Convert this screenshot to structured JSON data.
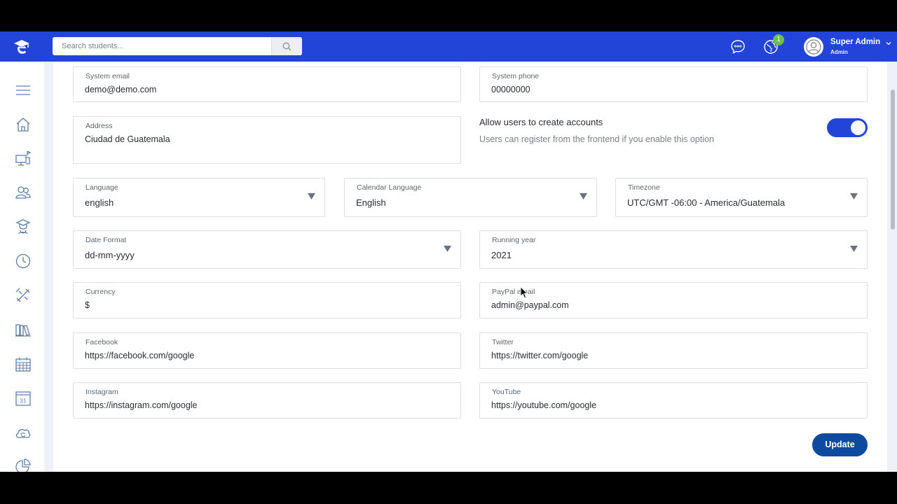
{
  "header": {
    "search_placeholder": "Search students...",
    "notification_count": "1",
    "user_name": "Super Admin",
    "user_role": "Admin",
    "brand_color": "#2244d8"
  },
  "sidebar": {
    "icons": [
      "menu-icon",
      "home-icon",
      "classroom-icon",
      "users-icon",
      "graduate-icon",
      "clock-icon",
      "tools-icon",
      "library-icon",
      "calendar-grid-icon",
      "calendar-31-icon",
      "cloud-sync-icon",
      "pie-chart-icon"
    ]
  },
  "form": {
    "system_email": {
      "label": "System email",
      "value": "demo@demo.com"
    },
    "system_phone": {
      "label": "System phone",
      "value": "00000000"
    },
    "address": {
      "label": "Address",
      "value": "Ciudad de Guatemala"
    },
    "allow_accounts": {
      "title": "Allow users to create accounts",
      "description": "Users can register from the frontend if you enable this option",
      "enabled": true
    },
    "language": {
      "label": "Language",
      "value": "english"
    },
    "calendar_language": {
      "label": "Calendar Language",
      "value": "English"
    },
    "timezone": {
      "label": "Timezone",
      "value": "UTC/GMT -06:00 - America/Guatemala"
    },
    "date_format": {
      "label": "Date Format",
      "value": "dd-mm-yyyy"
    },
    "running_year": {
      "label": "Running year",
      "value": "2021"
    },
    "currency": {
      "label": "Currency",
      "value": "$"
    },
    "paypal_email": {
      "label": "PayPal email",
      "value": "admin@paypal.com"
    },
    "facebook": {
      "label": "Facebook",
      "value": "https://facebook.com/google"
    },
    "twitter": {
      "label": "Twitter",
      "value": "https://twitter.com/google"
    },
    "instagram": {
      "label": "Instagram",
      "value": "https://instagram.com/google"
    },
    "youtube": {
      "label": "YouTube",
      "value": "https://youtube.com/google"
    },
    "update_label": "Update"
  }
}
